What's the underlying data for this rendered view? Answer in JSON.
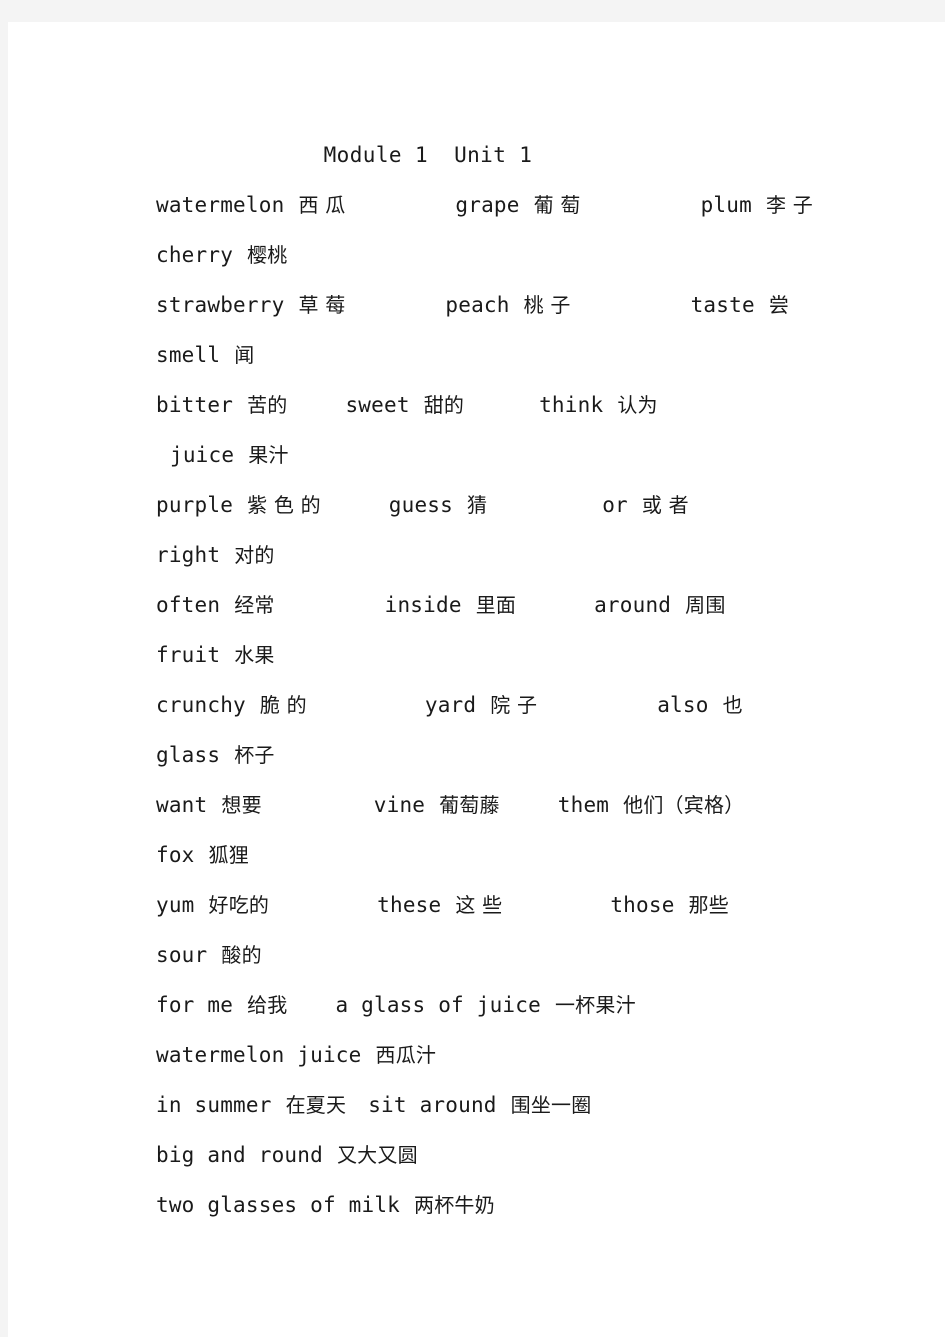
{
  "document": {
    "title": "Module 1  Unit 1",
    "page_background": "#ffffff",
    "surround_background": "#f4f4f4",
    "text_color": "#1a1a1a"
  },
  "lines": [
    {
      "id": "line-1",
      "indent": 0,
      "cells": [
        {
          "en": "watermelon",
          "cn": "西 瓜",
          "gap_after": 110
        },
        {
          "en": "grape",
          "cn": "葡 萄",
          "gap_after": 120
        },
        {
          "en": "plum",
          "cn": "李 子",
          "gap_after": 0
        }
      ]
    },
    {
      "id": "line-2",
      "indent": 0,
      "cells": [
        {
          "en": "cherry",
          "cn": "樱桃",
          "gap_after": 0
        }
      ]
    },
    {
      "id": "line-3",
      "indent": 0,
      "cells": [
        {
          "en": "strawberry",
          "cn": "草 莓",
          "gap_after": 100
        },
        {
          "en": "peach",
          "cn": "桃 子",
          "gap_after": 120
        },
        {
          "en": "taste",
          "cn": "尝",
          "gap_after": 0
        }
      ]
    },
    {
      "id": "line-4",
      "indent": 0,
      "cells": [
        {
          "en": "smell",
          "cn": "闻",
          "gap_after": 0
        }
      ]
    },
    {
      "id": "line-5",
      "indent": 0,
      "cells": [
        {
          "en": "bitter",
          "cn": "苦的",
          "gap_after": 58
        },
        {
          "en": "sweet",
          "cn": "甜的",
          "gap_after": 75
        },
        {
          "en": "think",
          "cn": "认为",
          "gap_after": 0
        }
      ]
    },
    {
      "id": "line-6",
      "indent": 14,
      "cells": [
        {
          "en": "juice",
          "cn": "果汁",
          "gap_after": 0
        }
      ]
    },
    {
      "id": "line-7",
      "indent": 0,
      "cells": [
        {
          "en": "purple",
          "cn": "紫 色 的",
          "gap_after": 68
        },
        {
          "en": "guess",
          "cn": "猜",
          "gap_after": 115
        },
        {
          "en": "or",
          "cn": "或 者",
          "gap_after": 0
        }
      ]
    },
    {
      "id": "line-8",
      "indent": 0,
      "cells": [
        {
          "en": "right",
          "cn": "对的",
          "gap_after": 0
        }
      ]
    },
    {
      "id": "line-9",
      "indent": 0,
      "cells": [
        {
          "en": "often",
          "cn": "经常",
          "gap_after": 110
        },
        {
          "en": "inside",
          "cn": "里面",
          "gap_after": 78
        },
        {
          "en": "around",
          "cn": "周围",
          "gap_after": 0
        }
      ]
    },
    {
      "id": "line-10",
      "indent": 0,
      "cells": [
        {
          "en": "fruit",
          "cn": "水果",
          "gap_after": 0
        }
      ]
    },
    {
      "id": "line-11",
      "indent": 0,
      "cells": [
        {
          "en": "crunchy",
          "cn": "脆 的",
          "gap_after": 118
        },
        {
          "en": "yard",
          "cn": "院 子",
          "gap_after": 120
        },
        {
          "en": "also",
          "cn": "也",
          "gap_after": 0
        }
      ]
    },
    {
      "id": "line-12",
      "indent": 0,
      "cells": [
        {
          "en": "glass",
          "cn": "杯子",
          "gap_after": 0
        }
      ]
    },
    {
      "id": "line-13",
      "indent": 0,
      "cells": [
        {
          "en": "want",
          "cn": "想要",
          "gap_after": 112
        },
        {
          "en": "vine",
          "cn": "葡萄藤",
          "gap_after": 58
        },
        {
          "en": "them",
          "cn": "他们（宾格）",
          "gap_after": 0
        }
      ]
    },
    {
      "id": "line-14",
      "indent": 0,
      "cells": [
        {
          "en": "fox",
          "cn": "狐狸",
          "gap_after": 0
        }
      ]
    },
    {
      "id": "line-15",
      "indent": 0,
      "cells": [
        {
          "en": "yum",
          "cn": "好吃的",
          "gap_after": 108
        },
        {
          "en": "these",
          "cn": "这 些",
          "gap_after": 108
        },
        {
          "en": "those",
          "cn": "那些",
          "gap_after": 0
        }
      ]
    },
    {
      "id": "line-16",
      "indent": 0,
      "cells": [
        {
          "en": "sour",
          "cn": "酸的",
          "gap_after": 0
        }
      ]
    },
    {
      "id": "line-17",
      "indent": 0,
      "cells": [
        {
          "en": "for me",
          "cn": "给我",
          "gap_after": 48
        },
        {
          "en": "a glass of juice",
          "cn": "一杯果汁",
          "gap_after": 0
        }
      ]
    },
    {
      "id": "line-18",
      "indent": 0,
      "cells": [
        {
          "en": "watermelon juice",
          "cn": "西瓜汁",
          "gap_after": 0
        }
      ]
    },
    {
      "id": "line-19",
      "indent": 0,
      "cells": [
        {
          "en": "in summer",
          "cn": "在夏天",
          "gap_after": 22
        },
        {
          "en": "sit around",
          "cn": "围坐一圈",
          "gap_after": 0
        }
      ]
    },
    {
      "id": "line-20",
      "indent": 0,
      "cells": [
        {
          "en": "big and round",
          "cn": "又大又圆",
          "gap_after": 0
        }
      ]
    },
    {
      "id": "line-21",
      "indent": 0,
      "cells": [
        {
          "en": "two glasses of milk",
          "cn": "两杯牛奶",
          "gap_after": 0
        }
      ]
    }
  ]
}
